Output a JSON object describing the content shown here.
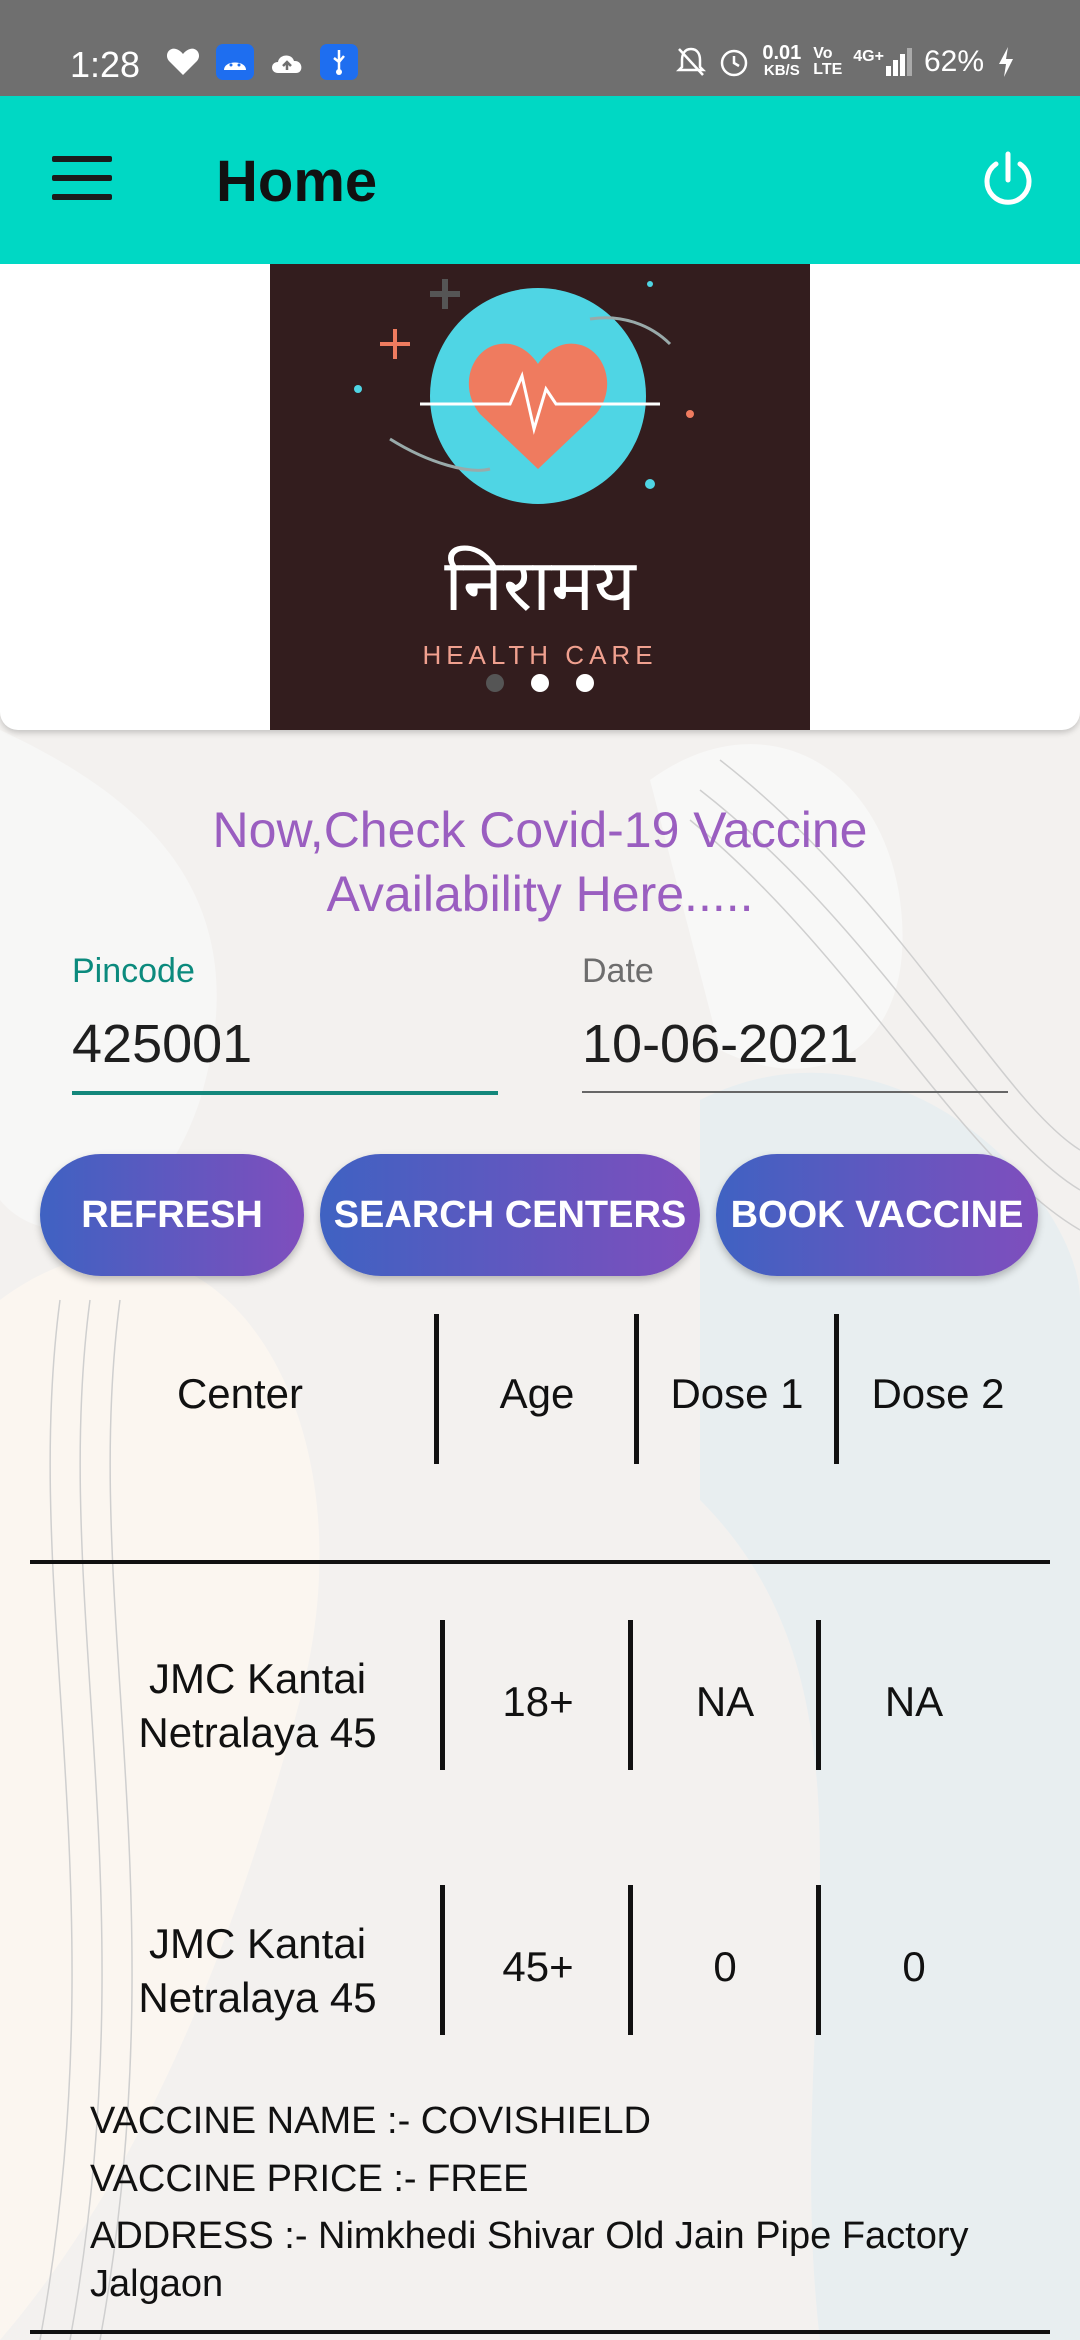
{
  "status_bar": {
    "time": "1:28",
    "net_speed_value": "0.01",
    "net_speed_unit": "KB/S",
    "volte": "Vo LTE",
    "network": "4G+",
    "battery": "62%"
  },
  "app_bar": {
    "title": "Home"
  },
  "banner": {
    "title": "निरामय",
    "subtitle": "HEALTH CARE",
    "active_slide": 0
  },
  "headline": {
    "line1": "Now,Check Covid-19 Vaccine",
    "line2": "Availability Here....."
  },
  "form": {
    "pincode_label": "Pincode",
    "pincode_value": "425001",
    "date_label": "Date",
    "date_value": "10-06-2021"
  },
  "buttons": {
    "refresh": "REFRESH",
    "search": "SEARCH CENTERS",
    "book": "BOOK VACCINE"
  },
  "table": {
    "headers": [
      "Center",
      "Age",
      "Dose 1",
      "Dose 2"
    ],
    "rows": [
      {
        "center_line1": "JMC Kantai",
        "center_line2": "Netralaya 45",
        "age": "18+",
        "dose1": "NA",
        "dose2": "NA"
      },
      {
        "center_line1": "JMC Kantai",
        "center_line2": "Netralaya 45",
        "age": "45+",
        "dose1": "0",
        "dose2": "0"
      }
    ]
  },
  "details": {
    "vaccine_name": "VACCINE NAME :- COVISHIELD",
    "vaccine_price": "VACCINE PRICE :- FREE",
    "address_line1": "ADDRESS :- Nimkhedi Shivar Old Jain Pipe Factory",
    "address_line2": "Jalgaon"
  },
  "colors": {
    "appbar": "#00d8c4",
    "accent_teal": "#13877b",
    "headline_purple": "#9a5ec0",
    "button_gradient_start": "#3f62c2",
    "button_gradient_end": "#7f4ebd"
  }
}
